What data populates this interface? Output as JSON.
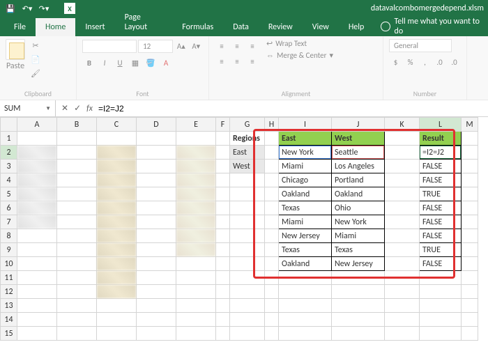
{
  "titlebar": {
    "filename": "datavalcombomergedepend.xlsm"
  },
  "tabs": {
    "file": "File",
    "home": "Home",
    "insert": "Insert",
    "page": "Page Layout",
    "formulas": "Formulas",
    "data": "Data",
    "review": "Review",
    "view": "View",
    "help": "Help",
    "tellme": "Tell me what you want to do"
  },
  "ribbon": {
    "paste": "Paste",
    "cut": "✂",
    "copy": "📄",
    "painter": "🖌",
    "font_size": "12",
    "wrap": "Wrap Text",
    "merge": "Merge & Center",
    "number_format": "General",
    "groups": {
      "clipboard": "Clipboard",
      "font": "Font",
      "alignment": "Alignment",
      "number": "Number"
    }
  },
  "fbar": {
    "name": "SUM",
    "formula": "=I2=J2",
    "fx": "fx"
  },
  "cols": [
    "A",
    "B",
    "C",
    "D",
    "E",
    "F",
    "G",
    "H",
    "I",
    "J",
    "K",
    "L",
    "M"
  ],
  "rows": [
    "1",
    "2",
    "3",
    "4",
    "5",
    "6",
    "7",
    "8",
    "9",
    "10",
    "11",
    "12",
    "13",
    "14",
    "15"
  ],
  "grid": {
    "regions_label": "Regions",
    "regions": [
      "East",
      "West"
    ],
    "east_label": "East",
    "west_label": "West",
    "result_label": "Result",
    "east": [
      "New York",
      "Miami",
      "Chicago",
      "Oakland",
      "Texas",
      "Miami",
      "New Jersey",
      "Texas",
      "Oakland"
    ],
    "west": [
      "Seattle",
      "Los Angeles",
      "Portland",
      "Oakland",
      "Ohio",
      "New York",
      "Miami",
      "Texas",
      "New Jersey"
    ],
    "results": [
      "=I2=J2",
      "FALSE",
      "FALSE",
      "TRUE",
      "FALSE",
      "FALSE",
      "FALSE",
      "TRUE",
      "FALSE"
    ]
  }
}
